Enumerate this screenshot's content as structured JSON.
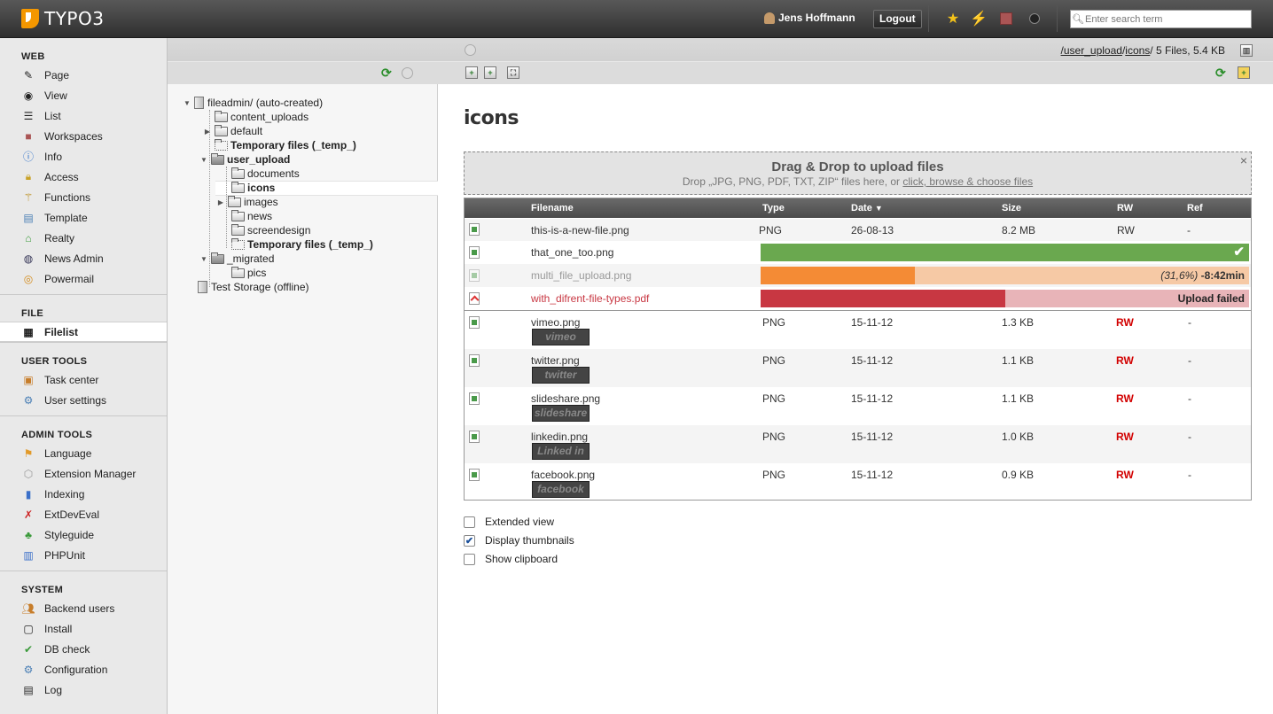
{
  "topbar": {
    "logo_text": "TYPO3",
    "user_name": "Jens Hoffmann",
    "logout_label": "Logout",
    "search_placeholder": "Enter search term"
  },
  "module_menu": [
    {
      "title": "WEB",
      "items": [
        "Page",
        "View",
        "List",
        "Workspaces",
        "Info",
        "Access",
        "Functions",
        "Template",
        "Realty",
        "News Admin",
        "Powermail"
      ]
    },
    {
      "title": "FILE",
      "items": [
        "Filelist"
      ]
    },
    {
      "title": "USER TOOLS",
      "items": [
        "Task center",
        "User settings"
      ]
    },
    {
      "title": "ADMIN TOOLS",
      "items": [
        "Language",
        "Extension Manager",
        "Indexing",
        "ExtDevEval",
        "Styleguide",
        "PHPUnit"
      ]
    },
    {
      "title": "SYSTEM",
      "items": [
        "Backend users",
        "Install",
        "DB check",
        "Configuration",
        "Log"
      ]
    }
  ],
  "tree": {
    "root": "fileadmin/ (auto-created)",
    "content_uploads": "content_uploads",
    "default": "default",
    "temp1": "Temporary files (_temp_)",
    "user_upload": "user_upload",
    "documents": "documents",
    "icons": "icons",
    "images": "images",
    "news": "news",
    "screendesign": "screendesign",
    "temp2": "Temporary files (_temp_)",
    "migrated": "_migrated",
    "pics": "pics",
    "test_storage": "Test Storage (offline)"
  },
  "path": {
    "seg1": "/user_upload",
    "seg2": "icons",
    "slash1": "/",
    "summary": "/ 5 Files, 5.4 KB"
  },
  "main": {
    "title": "icons",
    "dropzone_title": "Drag & Drop to upload files",
    "dropzone_sub": "Drop „JPG, PNG, PDF, TXT, ZIP“ files here, or ",
    "dropzone_link": "click, browse & choose files",
    "close_label": "×"
  },
  "table": {
    "headers": {
      "filename": "Filename",
      "type": "Type",
      "date": "Date",
      "size": "Size",
      "rw": "RW",
      "ref": "Ref"
    },
    "new_file": {
      "name": "this-is-a-new-file.png",
      "type": "PNG",
      "date": "26-08-13",
      "size": "8.2 MB",
      "rw": "RW",
      "ref": "-"
    },
    "uploads": [
      {
        "name": "that_one_too.png",
        "status": "done",
        "progress": 1.0
      },
      {
        "name": "multi_file_upload.png",
        "status": "uploading",
        "progress": 0.316,
        "pct_text": "(31,6%)",
        "eta_text": "-8:42min"
      },
      {
        "name": "with_difrent-file-types.pdf",
        "status": "failed",
        "progress": 0.5,
        "message": "Upload failed"
      }
    ],
    "files": [
      {
        "name": "vimeo.png",
        "type": "PNG",
        "date": "15-11-12",
        "size": "1.3 KB",
        "rw": "RW",
        "ref": "-",
        "thumb": "vimeo"
      },
      {
        "name": "twitter.png",
        "type": "PNG",
        "date": "15-11-12",
        "size": "1.1 KB",
        "rw": "RW",
        "ref": "-",
        "thumb": "twitter"
      },
      {
        "name": "slideshare.png",
        "type": "PNG",
        "date": "15-11-12",
        "size": "1.1 KB",
        "rw": "RW",
        "ref": "-",
        "thumb": "slideshare"
      },
      {
        "name": "linkedin.png",
        "type": "PNG",
        "date": "15-11-12",
        "size": "1.0 KB",
        "rw": "RW",
        "ref": "-",
        "thumb": "Linked in"
      },
      {
        "name": "facebook.png",
        "type": "PNG",
        "date": "15-11-12",
        "size": "0.9 KB",
        "rw": "RW",
        "ref": "-",
        "thumb": "facebook"
      }
    ]
  },
  "options": {
    "extended_view": {
      "label": "Extended view",
      "checked": false
    },
    "display_thumbnails": {
      "label": "Display thumbnails",
      "checked": true
    },
    "show_clipboard": {
      "label": "Show clipboard",
      "checked": false
    }
  },
  "colors": {
    "accent_orange": "#f49700",
    "progress_green": "#6aa84f",
    "progress_orange": "#f48b35",
    "progress_orange_bg": "#f6c9a5",
    "failed_red": "#c83742",
    "failed_bg": "#e8b4b8",
    "rw_red": "#d20000"
  }
}
